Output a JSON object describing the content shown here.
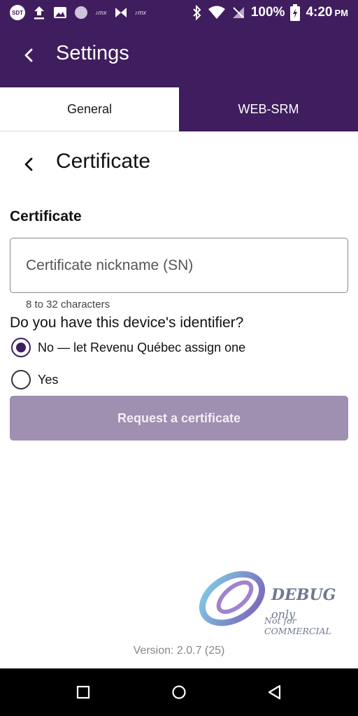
{
  "status_bar": {
    "sdt_badge": "SDT",
    "app_logo_small": "♪mx",
    "battery_percent": "100%",
    "time": "4:20",
    "time_suffix": "PM"
  },
  "app_bar": {
    "title": "Settings",
    "back_icon": "chevron-left-icon"
  },
  "tabs": [
    {
      "label": "General",
      "selected": true
    },
    {
      "label": "WEB-SRM",
      "selected": false
    }
  ],
  "section": {
    "title": "Certificate",
    "back_icon": "chevron-left-icon"
  },
  "form": {
    "field_label": "Certificate",
    "nickname_placeholder": "Certificate nickname (SN)",
    "nickname_value": "",
    "helper_text": "8 to 32 characters",
    "question": "Do you have this device's identifier?",
    "options": [
      {
        "label": "No — let Revenu Québec assign one",
        "selected": true
      },
      {
        "label": "Yes",
        "selected": false
      }
    ],
    "submit_label": "Request a certificate",
    "submit_enabled": false
  },
  "watermark": {
    "debug": "DEBUG",
    "only": "only",
    "not_for": "Not for COMMERCIAL"
  },
  "version_text": "Version: 2.0.7 (25)",
  "colors": {
    "primary": "#3f1d5e",
    "button_disabled": "#9f8fb0",
    "background": "#ffffff"
  }
}
